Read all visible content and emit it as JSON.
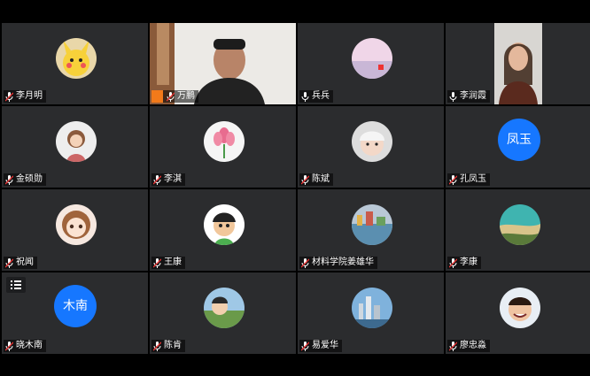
{
  "participants": [
    {
      "name": "李月明",
      "avatar": "pikachu-avatar-icon"
    },
    {
      "name": "万鹏",
      "avatar": "camera-video"
    },
    {
      "name": "兵兵",
      "avatar": "sky-photo-avatar-icon"
    },
    {
      "name": "李润霞",
      "avatar": "camera-video"
    },
    {
      "name": "金硕勋",
      "avatar": "cartoon-girl-avatar-icon"
    },
    {
      "name": "李淇",
      "avatar": "flower-avatar-icon"
    },
    {
      "name": "陈斌",
      "avatar": "baby-avatar-icon"
    },
    {
      "name": "孔凤玉",
      "avatar_text": "凤玉"
    },
    {
      "name": "祝闻",
      "avatar": "anime-girl-avatar-icon"
    },
    {
      "name": "王康",
      "avatar": "cartoon-boy-avatar-icon"
    },
    {
      "name": "材料学院姜雄华",
      "avatar": "waterfront-avatar-icon"
    },
    {
      "name": "李康",
      "avatar": "beach-avatar-icon"
    },
    {
      "name": "晓木南",
      "avatar_text": "木南"
    },
    {
      "name": "陈肯",
      "avatar": "anime-scene-avatar-icon"
    },
    {
      "name": "易爱华",
      "avatar": "city-skyline-avatar-icon"
    },
    {
      "name": "廖忠淼",
      "avatar": "smiling-boy-avatar-icon"
    }
  ],
  "colors": {
    "tile": "#2b2c2e",
    "accent": "#1677ff",
    "host": "#f27a1a",
    "active": "#3fae5a"
  }
}
